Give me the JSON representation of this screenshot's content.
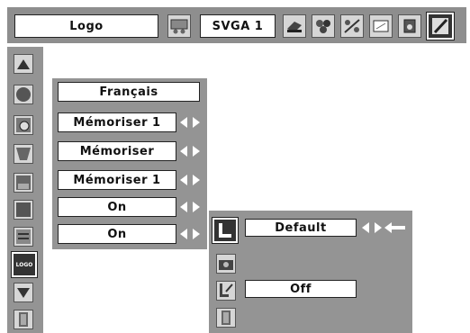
{
  "topbar": {
    "menu_title": "Logo",
    "resolution": "SVGA 1"
  },
  "left_icons": [
    "triangle-up-icon",
    "sphere-icon",
    "zoom-icon",
    "keystone-icon",
    "image-icon",
    "screen-icon",
    "menu-icon",
    "logo-icon",
    "triangle-down-icon",
    "door-icon"
  ],
  "left_icon_logo_text": "LOGO",
  "settings": [
    {
      "value": "Français",
      "has_arrows": false
    },
    {
      "value": "Mémoriser 1",
      "has_arrows": true
    },
    {
      "value": "Mémoriser",
      "has_arrows": true
    },
    {
      "value": "Mémoriser 1",
      "has_arrows": true
    },
    {
      "value": "On",
      "has_arrows": true
    },
    {
      "value": "On",
      "has_arrows": true
    }
  ],
  "submenu": {
    "logo_select": "Default",
    "logo_pin": "Off"
  }
}
